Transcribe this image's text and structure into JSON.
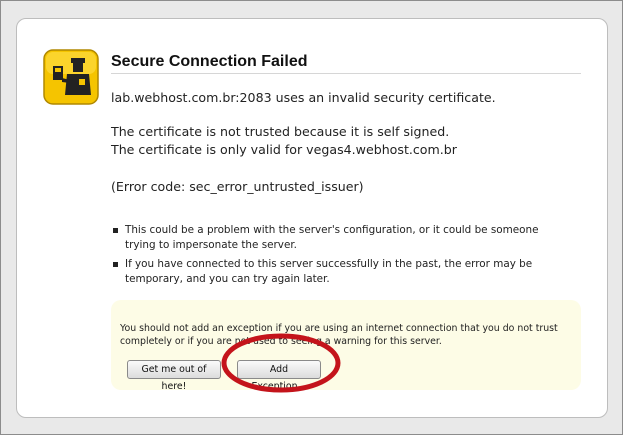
{
  "dialog": {
    "title": "Secure Connection Failed",
    "line_invalid_cert": "lab.webhost.com.br:2083 uses an invalid security certificate.",
    "line_not_trusted": "The certificate is not trusted because it is self signed.",
    "line_only_valid": "The certificate is only valid for vegas4.webhost.com.br",
    "error_code": "(Error code: sec_error_untrusted_issuer)",
    "bullets": [
      "This could be a problem with the server's configuration, or it could be someone trying to impersonate the server.",
      "If you have connected to this server successfully in the past, the error may be temporary, and you can try again later."
    ],
    "warning_text": "You should not add an exception if you are using an internet connection that you do not trust completely or if you are not used to seeing a warning for this server.",
    "buttons": {
      "get_out": "Get me out of here!",
      "add_exception": "Add Exception..."
    }
  },
  "colors": {
    "highlight_ring": "#c4141b",
    "warning_background": "#fdfce6",
    "icon_yellow": "#f5c400"
  },
  "icons": {
    "certificate_warning": "officer-badge-icon",
    "bullet": "square-bullet"
  }
}
